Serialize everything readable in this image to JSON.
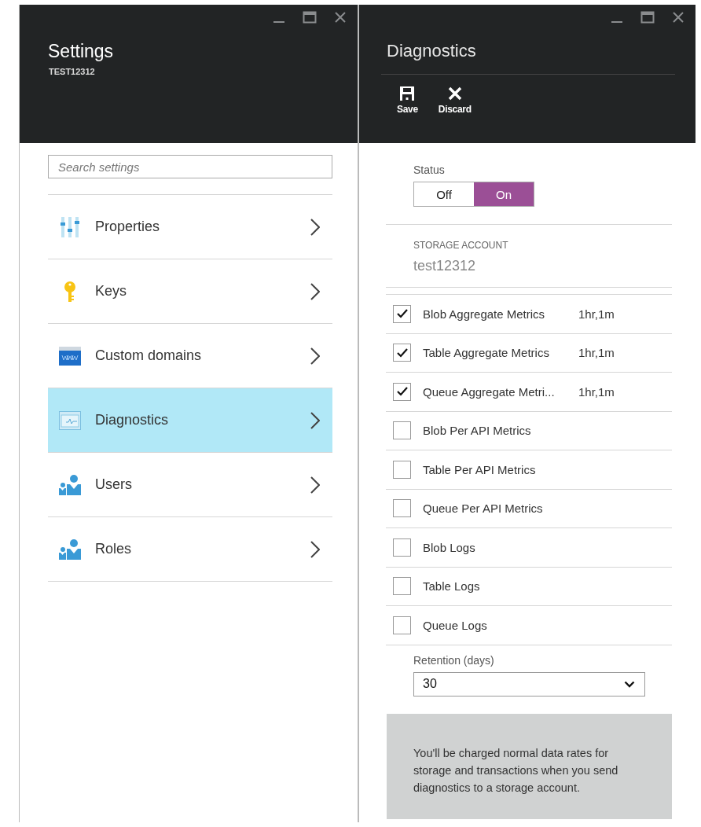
{
  "settings_blade": {
    "title": "Settings",
    "subtitle": "TEST12312",
    "search": {
      "placeholder": "Search settings"
    },
    "items": [
      {
        "label": "Properties",
        "kind": "properties",
        "selected": false
      },
      {
        "label": "Keys",
        "kind": "key",
        "selected": false
      },
      {
        "label": "Custom domains",
        "kind": "www",
        "selected": false
      },
      {
        "label": "Diagnostics",
        "kind": "diagnostics",
        "selected": true
      },
      {
        "label": "Users",
        "kind": "users",
        "selected": false
      },
      {
        "label": "Roles",
        "kind": "users",
        "selected": false
      }
    ]
  },
  "diagnostics_blade": {
    "title": "Diagnostics",
    "toolbar": [
      {
        "label": "Save",
        "kind": "save"
      },
      {
        "label": "Discard",
        "kind": "discard"
      }
    ],
    "status": {
      "label": "Status",
      "options": [
        {
          "label": "Off",
          "selected": false
        },
        {
          "label": "On",
          "selected": true
        }
      ]
    },
    "storage_account": {
      "label": "STORAGE ACCOUNT",
      "value": "test12312"
    },
    "metrics": [
      {
        "label": "Blob Aggregate Metrics",
        "value": "1hr,1m",
        "checked": true
      },
      {
        "label": "Table Aggregate Metrics",
        "value": "1hr,1m",
        "checked": true
      },
      {
        "label": "Queue Aggregate Metri...",
        "value": "1hr,1m",
        "checked": true
      },
      {
        "label": "Blob Per API Metrics",
        "checked": false
      },
      {
        "label": "Table Per API Metrics",
        "checked": false
      },
      {
        "label": "Queue Per API Metrics",
        "checked": false
      },
      {
        "label": "Blob Logs",
        "checked": false
      },
      {
        "label": "Table Logs",
        "checked": false
      },
      {
        "label": "Queue Logs",
        "checked": false
      }
    ],
    "retention": {
      "label": "Retention (days)",
      "value": "30"
    },
    "note": "You'll be charged normal data rates for storage and transactions when you send diagnostics to a storage account."
  }
}
